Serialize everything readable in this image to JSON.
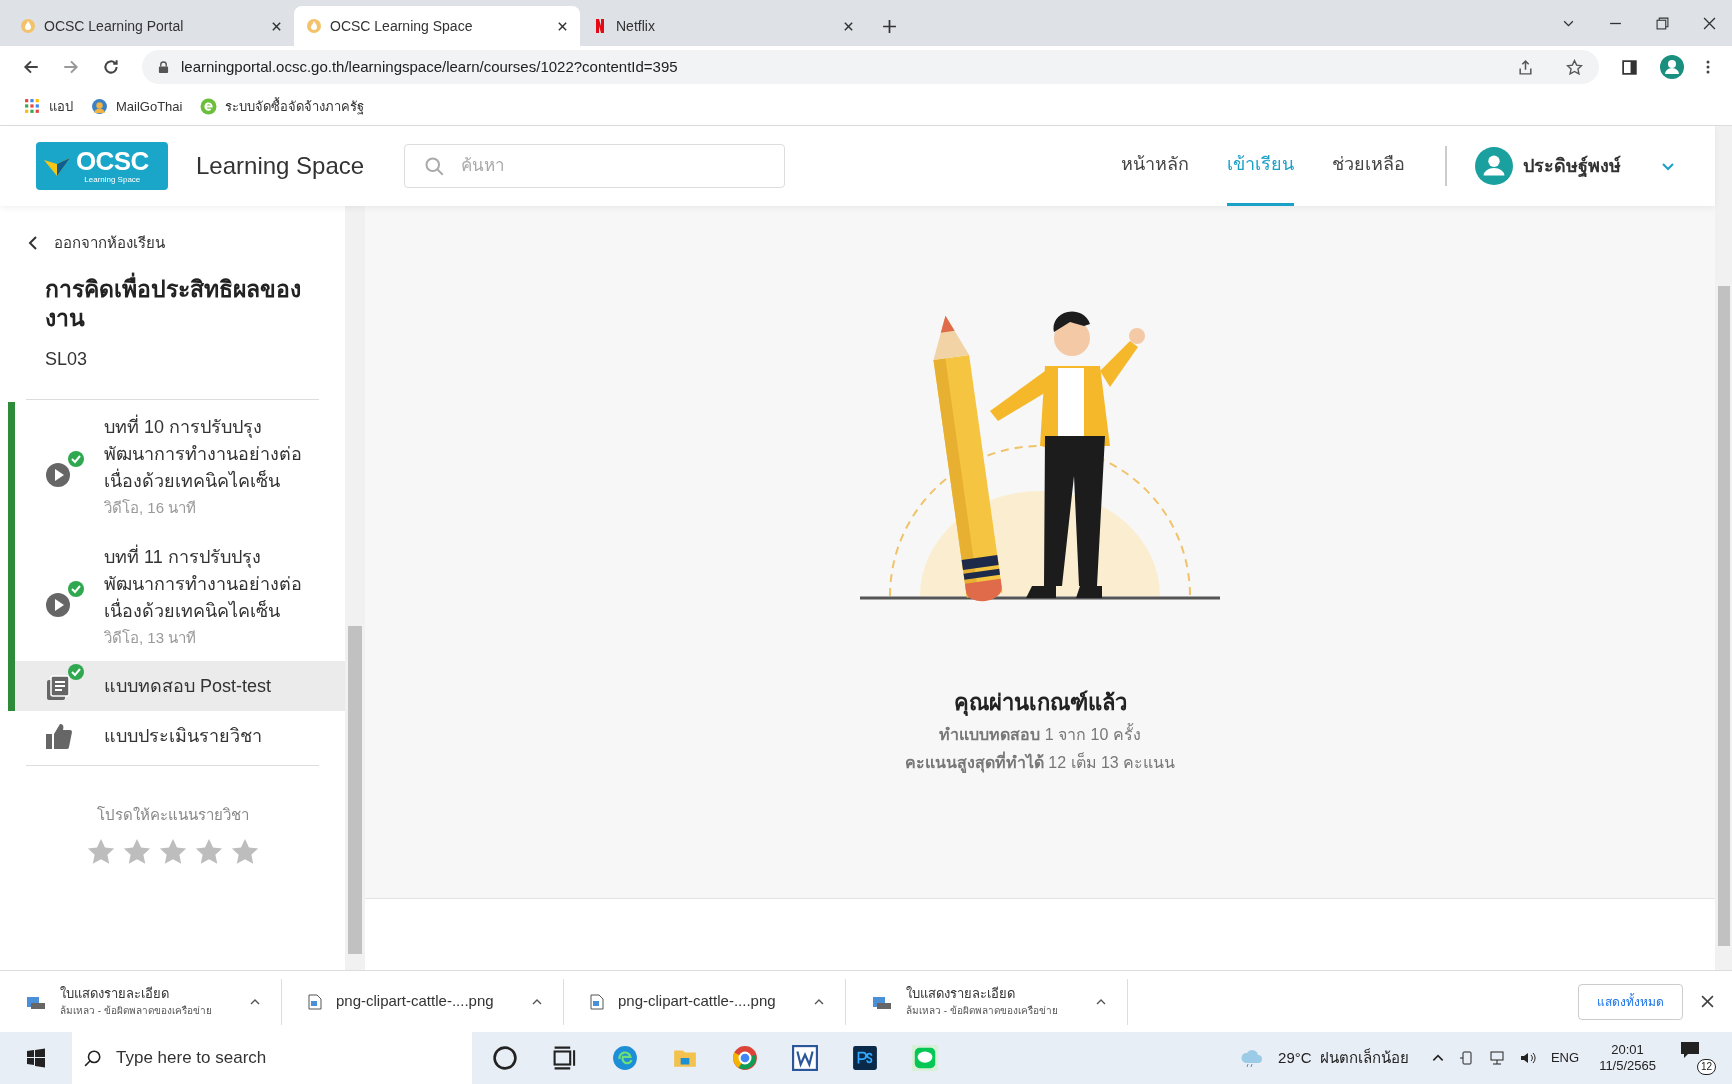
{
  "browser": {
    "tabs": [
      {
        "title": "OCSC Learning Portal",
        "selected": false
      },
      {
        "title": "OCSC Learning Space",
        "selected": true
      },
      {
        "title": "Netflix",
        "selected": false
      }
    ],
    "url": "learningportal.ocsc.go.th/learningspace/learn/courses/1022?contentId=395",
    "bookmarks": [
      {
        "label": "แอป"
      },
      {
        "label": "MailGoThai"
      },
      {
        "label": "ระบบจัดซื้อจัดจ้างภาครัฐ"
      }
    ]
  },
  "header": {
    "logo_text": "OCSC",
    "logo_sub": "Learning Space",
    "title": "Learning Space",
    "search": {
      "placeholder": "ค้นหา"
    },
    "nav": [
      {
        "label": "หน้าหลัก",
        "selected": false
      },
      {
        "label": "เข้าเรียน",
        "selected": true
      },
      {
        "label": "ช่วยเหลือ",
        "selected": false
      }
    ],
    "user": "ประดิษฐ์พงษ์"
  },
  "sidebar": {
    "back": "ออกจากห้องเรียน",
    "course_title": "การคิดเพื่อประสิทธิผลของงาน",
    "course_code": "SL03",
    "items": [
      {
        "kind": "video",
        "title": "บทที่ 10 การปรับปรุงพัฒนาการทำงานอย่างต่อเนื่องด้วยเทคนิคไคเซ็น",
        "meta": "วิดีโอ, 16 นาที",
        "completed": true,
        "selected": false
      },
      {
        "kind": "video",
        "title": "บทที่ 11 การปรับปรุงพัฒนาการทำงานอย่างต่อเนื่องด้วยเทคนิคไคเซ็น",
        "meta": "วิดีโอ, 13 นาที",
        "completed": true,
        "selected": false
      },
      {
        "kind": "quiz",
        "title": "แบบทดสอบ Post-test",
        "completed": true,
        "selected": true
      },
      {
        "kind": "survey",
        "title": "แบบประเมินรายวิชา",
        "completed": false,
        "selected": false
      }
    ],
    "rating": {
      "prompt": "โปรดให้คะแนนรายวิชา",
      "stars": 0
    }
  },
  "result": {
    "heading": "คุณผ่านเกณฑ์แล้ว",
    "lines": [
      "**ทำแบบทดสอบ** 1 จาก 10 ครั้ง",
      "**คะแนนสูงสุดที่ทำได้** 12 เต็ม 13 คะแนน"
    ]
  },
  "downloads": {
    "items": [
      {
        "kind": "failed",
        "name": "ใบแสดงรายละเอียด",
        "status": "ล้มเหลว - ข้อผิดพลาดของเครือข่าย"
      },
      {
        "kind": "file",
        "name": "png-clipart-cattle-....png"
      },
      {
        "kind": "file",
        "name": "png-clipart-cattle-....png"
      },
      {
        "kind": "failed",
        "name": "ใบแสดงรายละเอียด",
        "status": "ล้มเหลว - ข้อผิดพลาดของเครือข่าย"
      }
    ],
    "show_all": "แสดงทั้งหมด"
  },
  "taskbar": {
    "search_placeholder": "Type here to search",
    "weather": "29°C  ฝนตกเล็กน้อย",
    "language": "ENG",
    "time": "20:01",
    "date": "11/5/2565",
    "notifications": "12"
  }
}
